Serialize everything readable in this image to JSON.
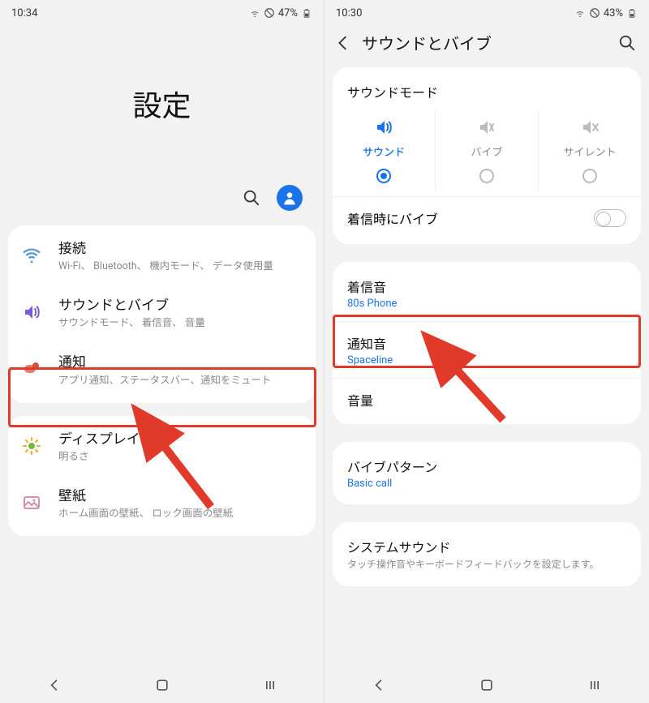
{
  "left": {
    "status": {
      "time": "10:34",
      "battery": "47%"
    },
    "hero_title": "設定",
    "items": [
      {
        "title": "接続",
        "sub": "Wi-Fi、 Bluetooth、 機内モード、 データ使用量"
      },
      {
        "title": "サウンドとバイブ",
        "sub": "サウンドモード、 着信音、 音量"
      },
      {
        "title": "通知",
        "sub": "アプリ通知、ステータスバー、通知をミュート"
      },
      {
        "title": "ディスプレイ",
        "sub": "明るさ"
      },
      {
        "title": "壁紙",
        "sub": "ホーム画面の壁紙、 ロック画面の壁紙"
      }
    ]
  },
  "right": {
    "status": {
      "time": "10:30",
      "battery": "43%"
    },
    "appbar_title": "サウンドとバイブ",
    "sound_mode": {
      "title": "サウンドモード",
      "options": [
        {
          "label": "サウンド",
          "selected": true
        },
        {
          "label": "バイブ",
          "selected": false
        },
        {
          "label": "サイレント",
          "selected": false
        }
      ],
      "vibrate_on_ring": "着信時にバイブ"
    },
    "ringtone": {
      "title": "着信音",
      "value": "80s Phone"
    },
    "notification_sound": {
      "title": "通知音",
      "value": "Spaceline"
    },
    "volume": {
      "title": "音量"
    },
    "vibration_pattern": {
      "title": "バイブパターン",
      "value": "Basic call"
    },
    "system_sound": {
      "title": "システムサウンド",
      "sub": "タッチ操作音やキーボードフィードバックを設定します。"
    }
  }
}
